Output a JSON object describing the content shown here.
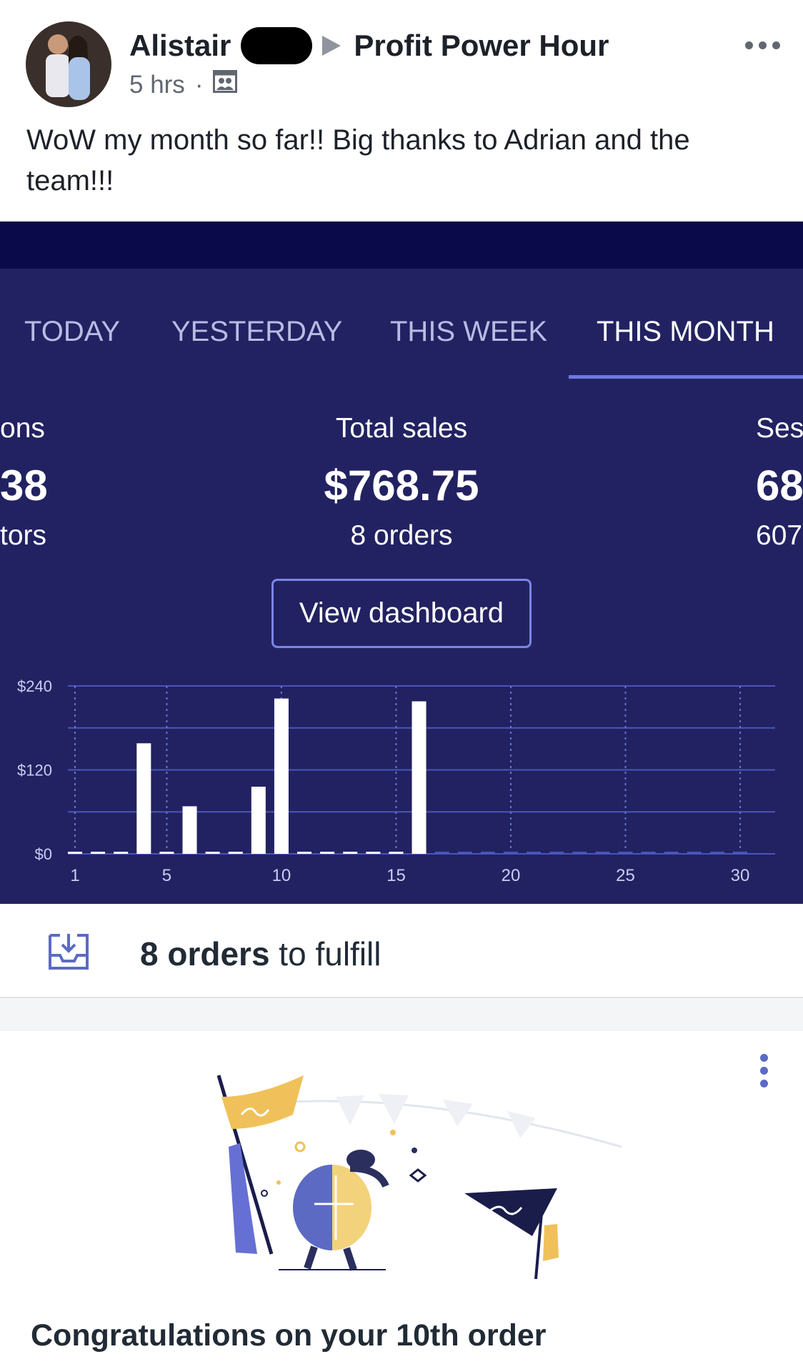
{
  "post": {
    "author": "Alistair",
    "group": "Profit Power Hour",
    "time": "5 hrs",
    "separator": "·",
    "audience_icon": "group-audience-icon",
    "text": "WoW my month so far!! Big thanks to Adrian and the team!!!"
  },
  "dashboard": {
    "tabs": [
      {
        "label": "TODAY",
        "active": false
      },
      {
        "label": "YESTERDAY",
        "active": false
      },
      {
        "label": "THIS WEEK",
        "active": false
      },
      {
        "label": "THIS MONTH",
        "active": true
      }
    ],
    "stats": {
      "left": {
        "label": "ons",
        "value": "38",
        "sub": "tors"
      },
      "center": {
        "label": "Total sales",
        "value": "$768.75",
        "sub": "8 orders"
      },
      "right": {
        "label": "Ses",
        "value": "68",
        "sub": "607"
      }
    },
    "view_button": "View dashboard"
  },
  "chart_data": {
    "type": "bar",
    "x": [
      1,
      2,
      3,
      4,
      5,
      6,
      7,
      8,
      9,
      10,
      11,
      12,
      13,
      14,
      15,
      16,
      17,
      18,
      19,
      20,
      21,
      22,
      23,
      24,
      25,
      26,
      27,
      28,
      29,
      30
    ],
    "values": [
      0,
      0,
      0,
      158,
      0,
      68,
      0,
      0,
      96,
      222,
      0,
      0,
      0,
      0,
      0,
      218,
      0,
      0,
      0,
      0,
      0,
      0,
      0,
      0,
      0,
      0,
      0,
      0,
      0,
      0
    ],
    "x_ticks": [
      "1",
      "5",
      "10",
      "15",
      "20",
      "25",
      "30"
    ],
    "x_tick_values": [
      1,
      5,
      10,
      15,
      20,
      25,
      30
    ],
    "y_ticks": [
      "$0",
      "$120",
      "$240"
    ],
    "y_tick_values": [
      0,
      120,
      240
    ],
    "ylim": [
      0,
      240
    ],
    "xlim": [
      1,
      30
    ],
    "grid": true,
    "bar_color": "#ffffff",
    "grid_color": "#4a55b8"
  },
  "fulfill": {
    "icon": "inbox-download-icon",
    "count": "8 orders",
    "rest": " to fulfill"
  },
  "card": {
    "menu_icon": "vertical-dots-icon",
    "illustration": "celebrating-turtle-illustration",
    "title": "Congratulations on your 10th order"
  },
  "colors": {
    "dashboard_bg": "#222262",
    "accent": "#5c6ac4"
  }
}
